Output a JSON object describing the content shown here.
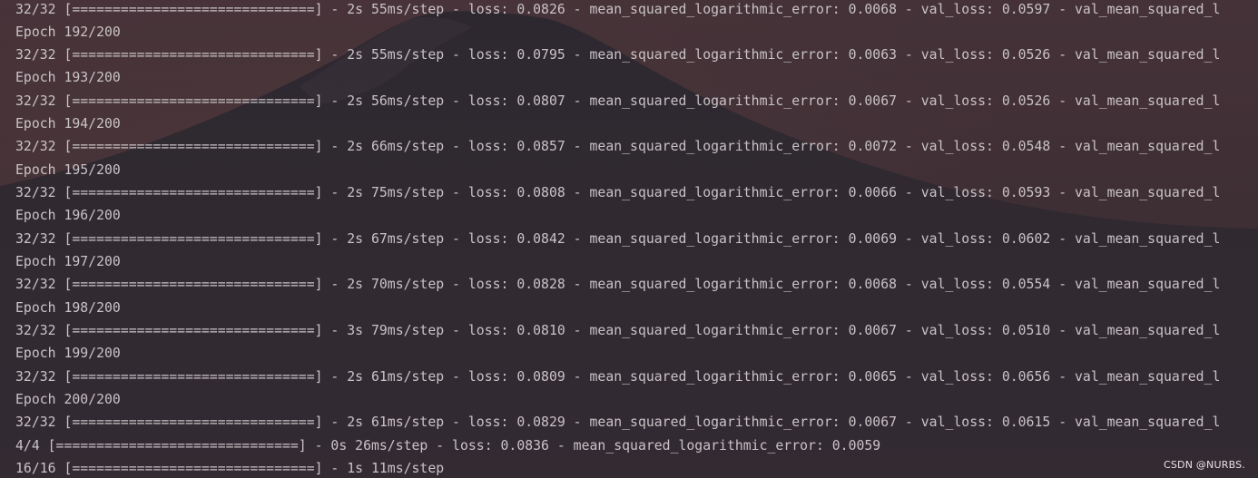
{
  "console": {
    "lines": [
      "32/32 [==============================] - 2s 55ms/step - loss: 0.0826 - mean_squared_logarithmic_error: 0.0068 - val_loss: 0.0597 - val_mean_squared_l",
      "Epoch 192/200",
      "32/32 [==============================] - 2s 55ms/step - loss: 0.0795 - mean_squared_logarithmic_error: 0.0063 - val_loss: 0.0526 - val_mean_squared_l",
      "Epoch 193/200",
      "32/32 [==============================] - 2s 56ms/step - loss: 0.0807 - mean_squared_logarithmic_error: 0.0067 - val_loss: 0.0526 - val_mean_squared_l",
      "Epoch 194/200",
      "32/32 [==============================] - 2s 66ms/step - loss: 0.0857 - mean_squared_logarithmic_error: 0.0072 - val_loss: 0.0548 - val_mean_squared_l",
      "Epoch 195/200",
      "32/32 [==============================] - 2s 75ms/step - loss: 0.0808 - mean_squared_logarithmic_error: 0.0066 - val_loss: 0.0593 - val_mean_squared_l",
      "Epoch 196/200",
      "32/32 [==============================] - 2s 67ms/step - loss: 0.0842 - mean_squared_logarithmic_error: 0.0069 - val_loss: 0.0602 - val_mean_squared_l",
      "Epoch 197/200",
      "32/32 [==============================] - 2s 70ms/step - loss: 0.0828 - mean_squared_logarithmic_error: 0.0068 - val_loss: 0.0554 - val_mean_squared_l",
      "Epoch 198/200",
      "32/32 [==============================] - 3s 79ms/step - loss: 0.0810 - mean_squared_logarithmic_error: 0.0067 - val_loss: 0.0510 - val_mean_squared_l",
      "Epoch 199/200",
      "32/32 [==============================] - 2s 61ms/step - loss: 0.0809 - mean_squared_logarithmic_error: 0.0065 - val_loss: 0.0656 - val_mean_squared_l",
      "Epoch 200/200",
      "32/32 [==============================] - 2s 61ms/step - loss: 0.0829 - mean_squared_logarithmic_error: 0.0067 - val_loss: 0.0615 - val_mean_squared_l",
      "4/4 [==============================] - 0s 26ms/step - loss: 0.0836 - mean_squared_logarithmic_error: 0.0059",
      "16/16 [==============================] - 1s 11ms/step"
    ]
  },
  "watermark": {
    "text": "CSDN @NURBS."
  },
  "colors": {
    "text": "#c9c3c6",
    "background": "#3f3238",
    "mountain": "#2f2a31"
  }
}
